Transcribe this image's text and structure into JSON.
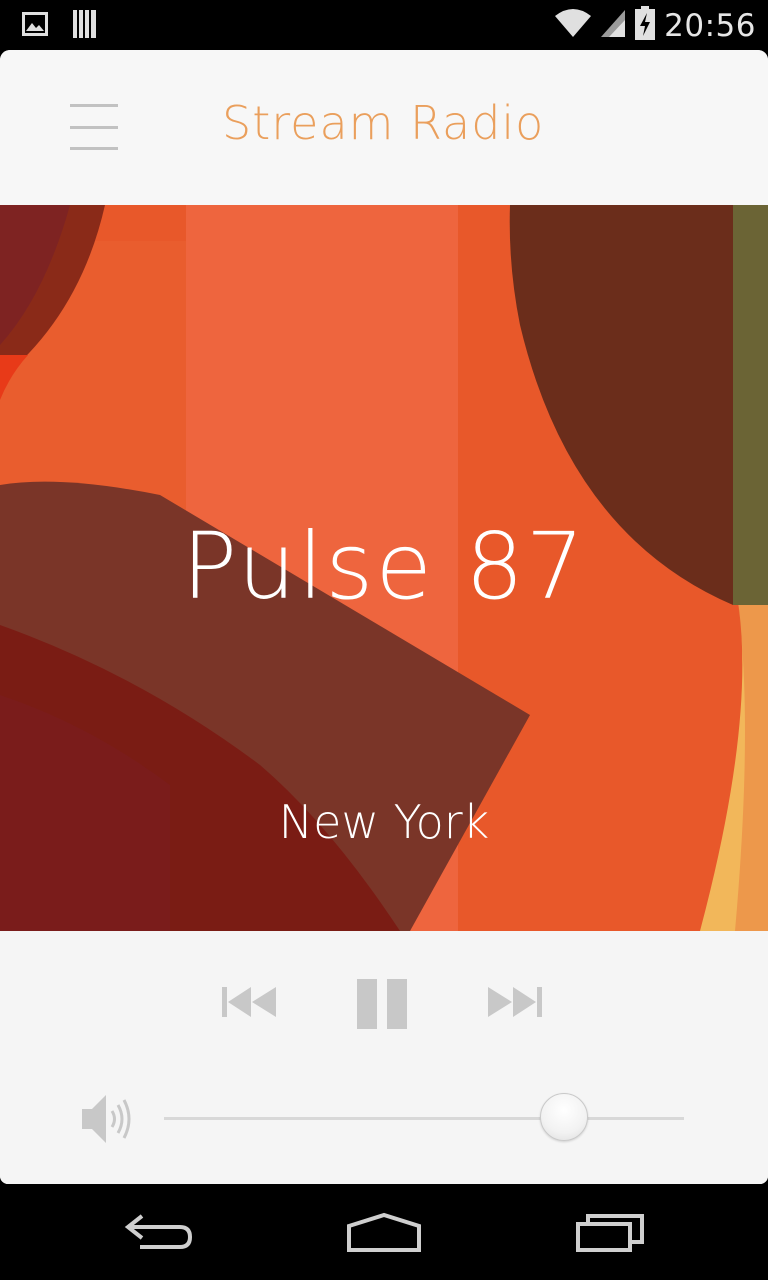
{
  "status_bar": {
    "time": "20:56",
    "icons": [
      "image-notification-icon",
      "storage-notification-icon",
      "wifi-icon",
      "cell-signal-icon",
      "battery-charging-icon"
    ]
  },
  "header": {
    "title": "Stream Radio",
    "menu_icon": "hamburger-menu-icon"
  },
  "now_playing": {
    "station": "Pulse 87",
    "city": "New York"
  },
  "controls": {
    "icons": [
      "previous-icon",
      "pause-icon",
      "next-icon"
    ]
  },
  "volume": {
    "icon": "volume-icon",
    "level": 0.77
  },
  "nav_bar": {
    "icons": [
      "back-icon",
      "home-icon",
      "recents-icon"
    ]
  },
  "colors": {
    "accent": "#ea9f5c",
    "artwork_base": "#e8582a",
    "control_gray": "#c8c8c8"
  }
}
